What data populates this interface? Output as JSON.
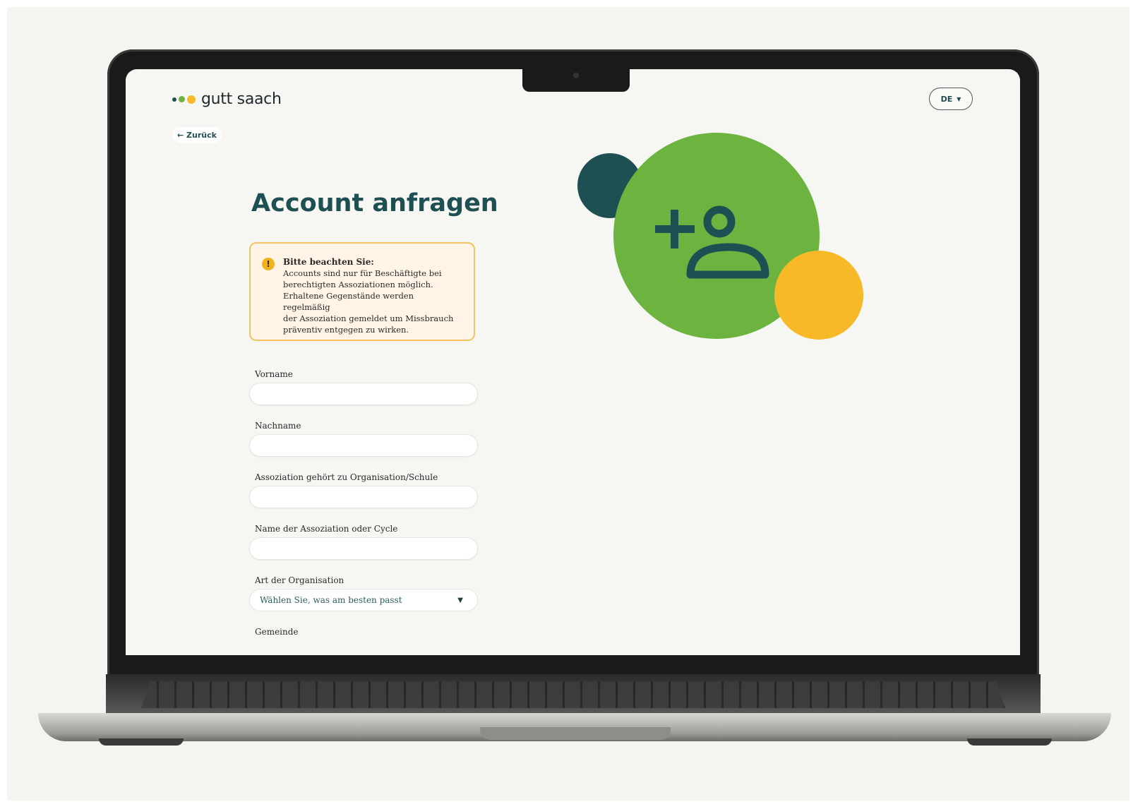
{
  "header": {
    "logo_text": "gutt saach",
    "logo_dot_colors": [
      "#1e4f53",
      "#6db33f",
      "#f7b928"
    ],
    "language": "DE",
    "back_label": "← Zurück"
  },
  "page": {
    "title": "Account anfragen"
  },
  "notice": {
    "icon": "!",
    "title": "Bitte beachten Sie:",
    "lines": [
      "Accounts sind nur für Beschäftigte bei",
      "berechtigten Assoziationen möglich.",
      "Erhaltene Gegenstände werden regelmäßig",
      "der Assoziation gemeldet um Missbrauch",
      "präventiv entgegen zu wirken."
    ]
  },
  "form": {
    "first_name": {
      "label": "Vorname",
      "value": ""
    },
    "last_name": {
      "label": "Nachname",
      "value": ""
    },
    "organisation": {
      "label": "Assoziation gehört zu Organisation/Schule",
      "value": ""
    },
    "association_name": {
      "label": "Name der Assoziation oder Cycle",
      "value": ""
    },
    "org_type": {
      "label": "Art der Organisation",
      "selected": "Wählen Sie, was am besten passt"
    },
    "municipality": {
      "label": "Gemeinde"
    }
  },
  "colors": {
    "brand_dark": "#1e4f53",
    "brand_green": "#6db33f",
    "brand_yellow": "#f7b928",
    "notice_bg": "#fff4e6",
    "notice_border": "#f2c462"
  },
  "illustration": {
    "icon": "add-user-icon"
  }
}
